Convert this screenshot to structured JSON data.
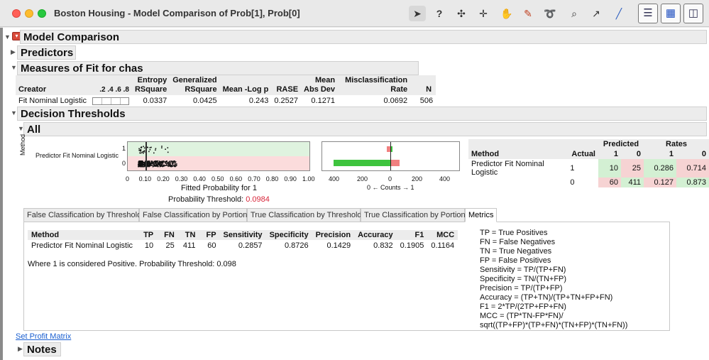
{
  "window": {
    "title": "Boston Housing - Model Comparison of Prob[1], Prob[0]"
  },
  "toolbar": {
    "help": "?"
  },
  "report": {
    "model_comparison": "Model Comparison",
    "predictors": "Predictors",
    "measures_title": "Measures of Fit for chas",
    "measures": {
      "headers": [
        [
          "Creator"
        ],
        [
          ".2 .4 .6 .8"
        ],
        [
          "Entropy",
          "RSquare"
        ],
        [
          "Generalized",
          "RSquare"
        ],
        [
          "Mean -Log p"
        ],
        [
          "RASE"
        ],
        [
          "Mean",
          "Abs Dev"
        ],
        [
          "Misclassification",
          "Rate"
        ],
        [
          "N"
        ]
      ],
      "row": [
        "Fit Nominal Logistic",
        "0.0337",
        "0.0425",
        "0.243",
        "0.2527",
        "0.1271",
        "0.0692",
        "506"
      ]
    },
    "decision_thresholds": "Decision Thresholds",
    "all": "All",
    "plot": {
      "method_axis": "Method",
      "row_label": "Predictor Fit Nominal Logistic",
      "y_ticks": [
        "1",
        "0"
      ],
      "x_ticks": [
        "0",
        "0.10",
        "0.20",
        "0.30",
        "0.40",
        "0.50",
        "0.60",
        "0.70",
        "0.80",
        "0.90",
        "1.00"
      ],
      "x_label": "Fitted Probability for 1",
      "threshold_label": "Probability Threshold:",
      "threshold_value": "0.0984",
      "threshold": 0.0984,
      "counts_ticks": [
        "400",
        "200",
        "0",
        "200",
        "400"
      ],
      "counts_label": "0 ← Counts → 1",
      "counts": {
        "actual1_pred0": 25,
        "actual1_pred1": 10,
        "actual0_pred0": 411,
        "actual0_pred1": 60
      }
    },
    "rates": {
      "predicted": "Predicted",
      "rates": "Rates",
      "method": "Method",
      "actual": "Actual",
      "col_1": "1",
      "col_0": "0",
      "method_name": "Predictor Fit Nominal Logistic",
      "rows": [
        {
          "actual": "1",
          "p1": "10",
          "p0": "25",
          "r1": "0.286",
          "r0": "0.714"
        },
        {
          "actual": "0",
          "p1": "60",
          "p0": "411",
          "r1": "0.127",
          "r0": "0.873"
        }
      ]
    },
    "tabs": [
      "False Classification by Threshold",
      "False Classification by Portion",
      "True Classification by Threshold",
      "True Classification by Portion",
      "Metrics"
    ],
    "metrics": {
      "headers": [
        "Method",
        "TP",
        "FN",
        "TN",
        "FP",
        "Sensitivity",
        "Specificity",
        "Precision",
        "Accuracy",
        "F1",
        "MCC"
      ],
      "row": [
        "Predictor Fit Nominal Logistic",
        "10",
        "25",
        "411",
        "60",
        "0.2857",
        "0.8726",
        "0.1429",
        "0.832",
        "0.1905",
        "0.1164"
      ],
      "note": "Where 1 is considered Positive.  Probability Threshold:  0.098",
      "definitions": [
        "TP = True Positives",
        "FN = False Negatives",
        "TN = True Negatives",
        "FP = False Positives",
        "Sensitivity = TP/(TP+FN)",
        "Specificity = TN/(TN+FP)",
        "Precision = TP/(TP+FP)",
        "Accuracy = (TP+TN)/(TP+TN+FP+FN)",
        "F1 = 2*TP/(2TP+FP+FN)",
        "MCC = (TP*TN-FP*FN)/",
        "sqrt((TP+FP)*(TP+FN)*(TN+FP)*(TN+FN))"
      ]
    },
    "set_profit_matrix": "Set Profit Matrix",
    "notes": "Notes"
  },
  "colors": {
    "red_band": "#fbdcdc",
    "green_band": "#dff3df",
    "green_bar": "#3ec43e",
    "red_bar": "#f08080",
    "threshold": "#d8263a"
  }
}
